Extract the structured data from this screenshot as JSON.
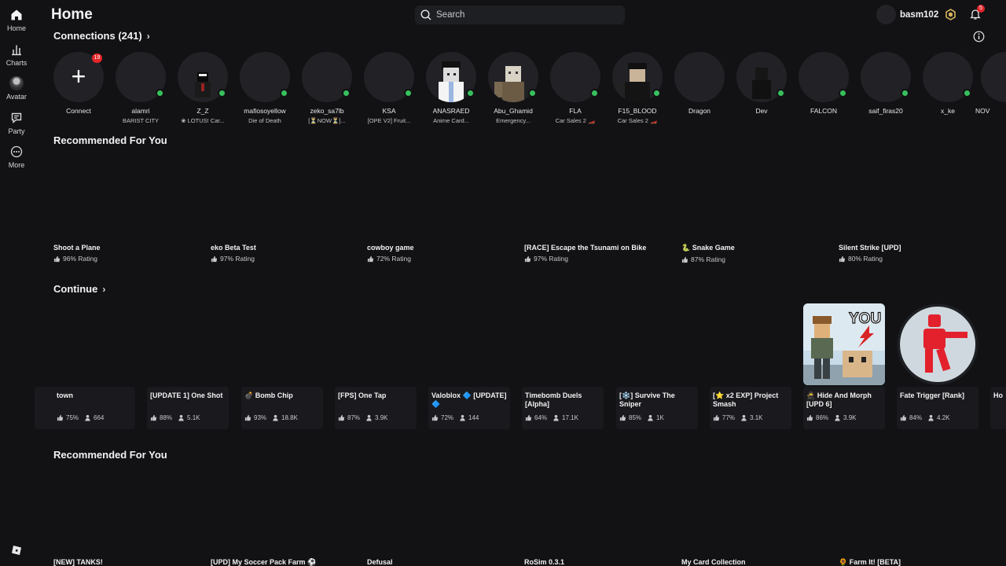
{
  "nav": {
    "items": [
      {
        "label": "Home",
        "icon": "home-icon"
      },
      {
        "label": "Charts",
        "icon": "charts-icon"
      },
      {
        "label": "Avatar",
        "icon": "avatar-icon"
      },
      {
        "label": "Party",
        "icon": "party-icon"
      },
      {
        "label": "More",
        "icon": "more-icon"
      }
    ]
  },
  "header": {
    "title": "Home",
    "search_placeholder": "Search",
    "username": "basm102",
    "notifications_count": "5"
  },
  "connections": {
    "title": "Connections (241)",
    "connect_label": "Connect",
    "connect_badge": "19",
    "friends": [
      {
        "name": "alamri",
        "status": "BARIST CITY",
        "online": true
      },
      {
        "name": "Z_Z",
        "status": "❀ LOTUS! Car...",
        "online": true
      },
      {
        "name": "mafiosoyellow",
        "status": "Die of Death",
        "online": true
      },
      {
        "name": "zeko_sa7lb",
        "status": "[⏳NOW⏳]...",
        "online": true
      },
      {
        "name": "KSA",
        "status": "[OPE V2] Fruit...",
        "online": true
      },
      {
        "name": "ANASRAED",
        "status": "Anime Card...",
        "online": true
      },
      {
        "name": "Abu_Ghamid",
        "status": "Emergency...",
        "online": true
      },
      {
        "name": "FLA",
        "status": "Car Sales 2 🏎️",
        "online": true
      },
      {
        "name": "F15_BLOOD",
        "status": "Car Sales 2 🏎️",
        "online": true
      },
      {
        "name": "Dragon",
        "status": "",
        "online": false
      },
      {
        "name": "Dev",
        "status": "",
        "online": true
      },
      {
        "name": "FALCON",
        "status": "",
        "online": true
      },
      {
        "name": "saif_firas20",
        "status": "",
        "online": true
      },
      {
        "name": "x_ke",
        "status": "",
        "online": true
      },
      {
        "name": "NOV",
        "status": "",
        "online": false
      }
    ]
  },
  "recommended1": {
    "title": "Recommended For You",
    "games": [
      {
        "name": "Shoot a Plane",
        "rating": "96% Rating"
      },
      {
        "name": "eko Beta Test",
        "rating": "97% Rating"
      },
      {
        "name": "cowboy game",
        "rating": "72% Rating"
      },
      {
        "name": "[RACE] Escape the Tsunami on Bike",
        "rating": "97% Rating"
      },
      {
        "name": "🐍 Snake Game",
        "rating": "87% Rating"
      },
      {
        "name": "Silent Strike [UPD]",
        "rating": "80% Rating"
      }
    ]
  },
  "continue": {
    "title": "Continue",
    "games": [
      {
        "name": "town",
        "rating": "75%",
        "players": "664"
      },
      {
        "name": "[UPDATE 1] One Shot",
        "rating": "88%",
        "players": "5.1K"
      },
      {
        "name": "💣 Bomb Chip",
        "rating": "93%",
        "players": "18.8K"
      },
      {
        "name": "[FPS] One Tap",
        "rating": "87%",
        "players": "3.9K"
      },
      {
        "name": "Valoblox 🔷 [UPDATE] 🔷",
        "rating": "72%",
        "players": "144"
      },
      {
        "name": "Timebomb Duels [Alpha]",
        "rating": "64%",
        "players": "17.1K"
      },
      {
        "name": "[❄️] Survive The Sniper",
        "rating": "85%",
        "players": "1K"
      },
      {
        "name": "[⭐ x2 EXP] Project Smash",
        "rating": "77%",
        "players": "3.1K"
      },
      {
        "name": "🥷 Hide And Morph [UPD 6]",
        "rating": "86%",
        "players": "3.9K"
      },
      {
        "name": "Fate Trigger [Rank]",
        "rating": "84%",
        "players": "4.2K"
      },
      {
        "name": "Ho",
        "rating": "",
        "players": ""
      }
    ],
    "thumb_text": "YOU"
  },
  "recommended2": {
    "title": "Recommended For You",
    "games": [
      {
        "name": "[NEW] TANKS!"
      },
      {
        "name": "[UPD] My Soccer Pack Farm ⚽"
      },
      {
        "name": "Defusal"
      },
      {
        "name": "RoSim 0.3.1"
      },
      {
        "name": "My Card Collection"
      },
      {
        "name": "🌻 Farm It! [BETA]"
      }
    ]
  },
  "colors": {
    "background": "#121215",
    "online": "#38c05d",
    "badge": "#e3272b",
    "search_bg": "#1e1f23"
  }
}
